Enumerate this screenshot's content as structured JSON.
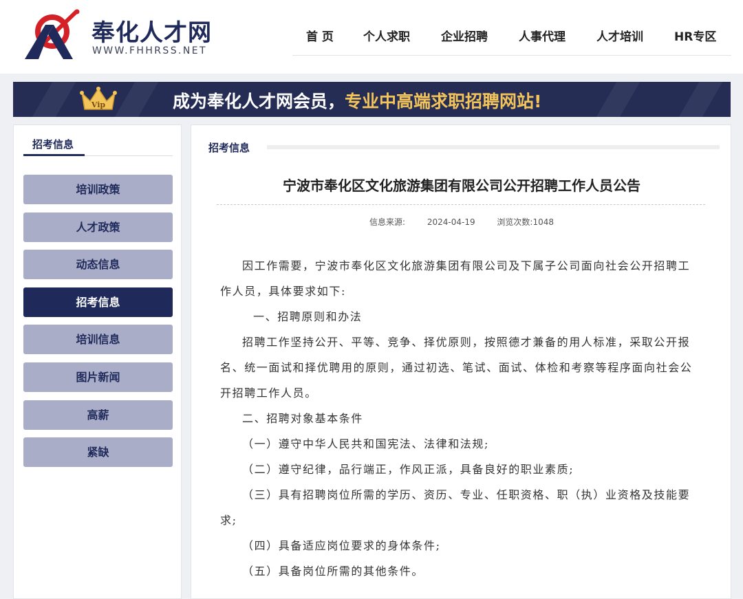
{
  "header": {
    "brand_name": "奉化人才网",
    "brand_url": "WWW.FHHRSS.NET",
    "nav": [
      "首 页",
      "个人求职",
      "企业招聘",
      "人事代理",
      "人才培训",
      "HR专区"
    ]
  },
  "banner": {
    "crown_text": "Vip",
    "text_white": "成为奉化人才网会员，",
    "text_yellow": "专业中高端求职招聘网站!"
  },
  "sidebar": {
    "title": "招考信息",
    "items": [
      {
        "label": "培训政策",
        "active": false
      },
      {
        "label": "人才政策",
        "active": false
      },
      {
        "label": "动态信息",
        "active": false
      },
      {
        "label": "招考信息",
        "active": true
      },
      {
        "label": "培训信息",
        "active": false
      },
      {
        "label": "图片新闻",
        "active": false
      },
      {
        "label": "高薪",
        "active": false
      },
      {
        "label": "紧缺",
        "active": false
      }
    ]
  },
  "main": {
    "section_title": "招考信息",
    "article_title": "宁波市奉化区文化旅游集团有限公司公开招聘工作人员公告",
    "meta": {
      "source_label": "信息来源:",
      "date": "2024-04-19",
      "views": "浏览次数:1048"
    },
    "paragraphs": [
      "因工作需要，宁波市奉化区文化旅游集团有限公司及下属子公司面向社会公开招聘工作人员，具体要求如下:",
      "一、招聘原则和办法",
      "招聘工作坚持公开、平等、竞争、择优原则，按照德才兼备的用人标准，采取公开报名、统一面试和择优聘用的原则，通过初选、笔试、面试、体检和考察等程序面向社会公开招聘工作人员。",
      "二、招聘对象基本条件",
      "（一）遵守中华人民共和国宪法、法律和法规;",
      "（二）遵守纪律，品行端正，作风正派，具备良好的职业素质;",
      "（三）具有招聘岗位所需的学历、资历、专业、任职资格、职（执）业资格及技能要求;",
      "（四）具备适应岗位要求的身体条件;",
      "（五）具备岗位所需的其他条件。"
    ]
  },
  "colors": {
    "primary": "#1f2a5a",
    "accent_red": "#d42127",
    "banner_yellow": "#f3c45a",
    "sidebar_button": "#a9adc8"
  }
}
